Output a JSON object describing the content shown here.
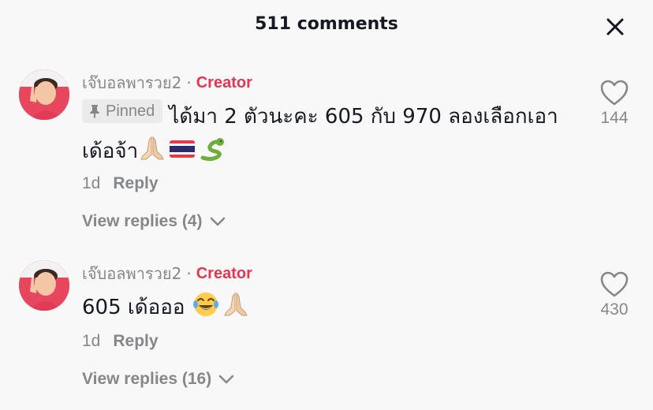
{
  "header": {
    "title": "511 comments",
    "close_icon": "close-icon"
  },
  "colors": {
    "accent": "#e3364f",
    "muted": "#86878b",
    "text": "#161823",
    "pinned_bg": "#ebebeb",
    "background": "#f8f8f8"
  },
  "comments": [
    {
      "username": "เจ๊บอลพารวย2",
      "separator": "·",
      "badge": "Creator",
      "pinned_label": "Pinned",
      "text": "ได้มา 2 ตัวนะคะ 605 กับ 970 ลองเลือกเอาเด้อจ้า",
      "emojis": [
        "folded-hands-emoji",
        "thailand-flag-emoji",
        "snake-emoji"
      ],
      "time": "1d",
      "reply_label": "Reply",
      "view_replies": "View replies (4)",
      "likes": "144"
    },
    {
      "username": "เจ๊บอลพารวย2",
      "separator": "·",
      "badge": "Creator",
      "text": "605 เด้อออ",
      "emojis": [
        "tears-of-joy-emoji",
        "folded-hands-emoji"
      ],
      "time": "1d",
      "reply_label": "Reply",
      "view_replies": "View replies (16)",
      "likes": "430"
    }
  ]
}
